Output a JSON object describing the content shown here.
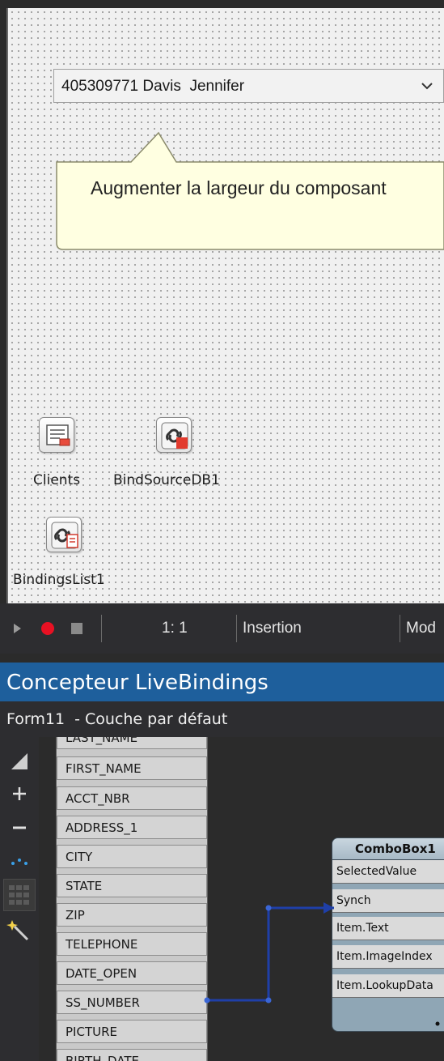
{
  "designer": {
    "combo_value": "405309771 Davis  Jennifer",
    "callout_text": "Augmenter la largeur du composant",
    "components": [
      {
        "label": "Clients",
        "icon": "dataset-icon"
      },
      {
        "label": "BindSourceDB1",
        "icon": "bind-source-icon"
      },
      {
        "label": "BindingsList1",
        "icon": "bindings-list-icon"
      }
    ]
  },
  "statusbar": {
    "position": "1:  1",
    "mode": "Insertion",
    "mod_label": "Mod"
  },
  "livebindings": {
    "title": "Concepteur LiveBindings",
    "subtitle": "Form11  - Couche par défaut",
    "fields": [
      "LAST_NAME",
      "FIRST_NAME",
      "ACCT_NBR",
      "ADDRESS_1",
      "CITY",
      "STATE",
      "ZIP",
      "TELEPHONE",
      "DATE_OPEN",
      "SS_NUMBER",
      "PICTURE",
      "BIRTH_DATE"
    ],
    "combo_node": {
      "name": "ComboBox1",
      "members": [
        "SelectedValue",
        "Synch",
        "Item.Text",
        "Item.ImageIndex",
        "Item.LookupData"
      ]
    },
    "link": {
      "from": "SS_NUMBER",
      "to": "Item.Text",
      "color": "#1f3fa8"
    }
  }
}
